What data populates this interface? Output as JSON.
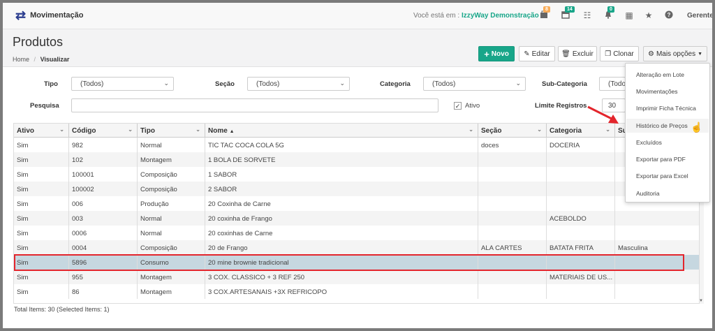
{
  "app": {
    "title": "Movimentação",
    "location_prefix": "Você está em :",
    "location_name": "IzzyWay Demonstração",
    "user": "Gerente",
    "badges": {
      "orders": "8",
      "calendar": "14",
      "bell": "0"
    },
    "colors": {
      "accent": "#18a689",
      "brand": "#2c3e8f",
      "badge_orange": "#f8ac59",
      "highlight_red": "#e3252c",
      "selected_row": "#c6d7e0"
    }
  },
  "page": {
    "title": "Produtos",
    "breadcrumb": [
      "Home",
      "Visualizar"
    ],
    "breadcrumb_sep": "/"
  },
  "toolbar": {
    "new_label": "Novo",
    "edit_label": "Editar",
    "delete_label": "Excluir",
    "clone_label": "Clonar",
    "more_label": "Mais opções"
  },
  "filters": {
    "tipo_label": "Tipo",
    "tipo_value": "(Todos)",
    "secao_label": "Seção",
    "secao_value": "(Todos)",
    "categoria_label": "Categoria",
    "categoria_value": "(Todos)",
    "subcategoria_label": "Sub-Categoria",
    "subcategoria_value": "(Todo",
    "pesquisa_label": "Pesquisa",
    "pesquisa_value": "",
    "ativo_label": "Ativo",
    "ativo_checked": true,
    "limite_label": "Limite Registros",
    "limite_value": "30"
  },
  "grid": {
    "columns": [
      "Ativo",
      "Código",
      "Tipo",
      "Nome",
      "Seção",
      "Categoria",
      "Su"
    ],
    "sort_column": "Nome",
    "rows": [
      [
        "Sim",
        "982",
        "Normal",
        "TIC TAC COCA COLA 5G",
        "doces",
        "DOCERIA",
        ""
      ],
      [
        "Sim",
        "102",
        "Montagem",
        "1 BOLA DE SORVETE",
        "",
        "",
        ""
      ],
      [
        "Sim",
        "100001",
        "Composição",
        "1 SABOR",
        "",
        "",
        ""
      ],
      [
        "Sim",
        "100002",
        "Composição",
        "2 SABOR",
        "",
        "",
        ""
      ],
      [
        "Sim",
        "006",
        "Produção",
        "20 Coxinha de Carne",
        "",
        "",
        ""
      ],
      [
        "Sim",
        "003",
        "Normal",
        "20 coxinha de Frango",
        "",
        "ACEBOLDO",
        ""
      ],
      [
        "Sim",
        "0006",
        "Normal",
        "20 coxinhas de Carne",
        "",
        "",
        ""
      ],
      [
        "Sim",
        "0004",
        "Composição",
        "20 de Frango",
        "ALA CARTES",
        "BATATA FRITA",
        "Masculina"
      ],
      [
        "Sim",
        "5896",
        "Consumo",
        "20 mine brownie tradicional",
        "",
        "",
        ""
      ],
      [
        "Sim",
        "955",
        "Montagem",
        "3 COX. CLASSICO + 3 REF 250",
        "",
        "MATERIAIS DE US...",
        ""
      ],
      [
        "Sim",
        "86",
        "Montagem",
        "3 COX.ARTESANAIS +3X REFRICOPO",
        "",
        "",
        ""
      ]
    ],
    "selected_row_index": 8,
    "footer": "Total Items: 30 (Selected Items: 1)"
  },
  "more_menu": {
    "items": [
      "Alteração em Lote",
      "Movimentações",
      "Imprimir Ficha Técnica",
      "Histórico de Preços",
      "Excluídos",
      "Exportar para PDF",
      "Exportar para Excel",
      "Auditoria"
    ],
    "hovered_index": 3
  }
}
